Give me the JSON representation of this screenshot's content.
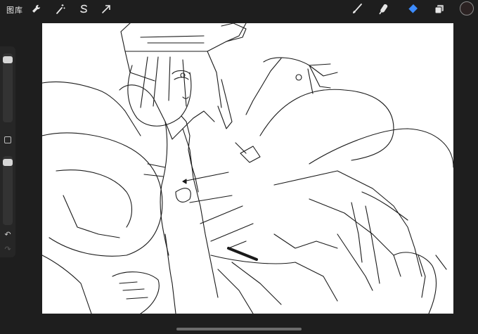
{
  "toolbar": {
    "gallery_label": "图库",
    "left_tools": [
      {
        "name": "actions",
        "icon": "wrench-icon"
      },
      {
        "name": "adjustments",
        "icon": "magic-wand-icon"
      },
      {
        "name": "selection",
        "icon": "selection-s-icon"
      },
      {
        "name": "transform",
        "icon": "arrow-cursor-icon"
      }
    ],
    "right_tools": [
      {
        "name": "brush",
        "icon": "brush-icon"
      },
      {
        "name": "smudge",
        "icon": "smudge-icon"
      },
      {
        "name": "eraser",
        "icon": "eraser-icon",
        "active": true
      },
      {
        "name": "layers",
        "icon": "layers-icon"
      }
    ],
    "active_tool_color": "#3d8cff",
    "current_color": "#2b2222"
  },
  "sidebar": {
    "brush_size_level": 0.04,
    "opacity_level": 0.05,
    "modify_icon": "square-icon",
    "undo_icon": "undo-arrow-icon",
    "redo_icon": "redo-arrow-icon"
  },
  "canvas": {
    "background": "#ffffff",
    "content": "line-art-sketch"
  }
}
